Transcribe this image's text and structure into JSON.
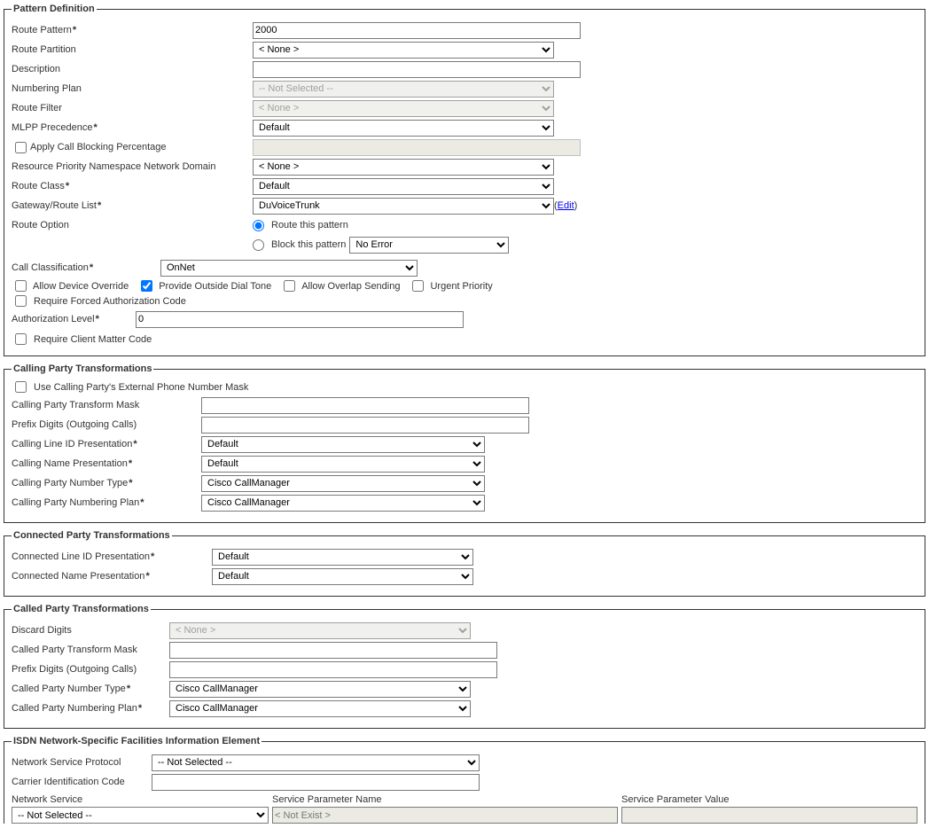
{
  "pd": {
    "legend": "Pattern Definition",
    "route_pattern_label": "Route Pattern",
    "route_pattern_value": "2000",
    "route_partition_label": "Route Partition",
    "route_partition_value": "< None >",
    "description_label": "Description",
    "description_value": "",
    "numbering_plan_label": "Numbering Plan",
    "numbering_plan_value": "-- Not Selected --",
    "route_filter_label": "Route Filter",
    "route_filter_value": "< None >",
    "mlpp_label": "MLPP Precedence",
    "mlpp_value": "Default",
    "apply_blocking_label": "Apply Call Blocking Percentage",
    "rpnnd_label": "Resource Priority Namespace Network Domain",
    "rpnnd_value": "< None >",
    "route_class_label": "Route Class",
    "route_class_value": "Default",
    "gateway_label": "Gateway/Route List",
    "gateway_value": "DuVoiceTrunk",
    "edit_text": "Edit",
    "route_option_label": "Route Option",
    "route_this_label": "Route this pattern",
    "block_this_label": "Block this pattern",
    "block_reason_value": "No Error",
    "call_class_label": "Call Classification",
    "call_class_value": "OnNet",
    "allow_device_override": "Allow Device Override",
    "provide_dial_tone": "Provide Outside Dial Tone",
    "allow_overlap": "Allow Overlap Sending",
    "urgent_priority": "Urgent Priority",
    "require_fac": "Require Forced Authorization Code",
    "auth_level_label": "Authorization Level",
    "auth_level_value": "0",
    "require_cmc": "Require Client Matter Code"
  },
  "cp": {
    "legend": "Calling Party Transformations",
    "use_mask_label": "Use Calling Party's External Phone Number Mask",
    "transform_mask_label": "Calling Party Transform Mask",
    "transform_mask_value": "",
    "prefix_label": "Prefix Digits (Outgoing Calls)",
    "prefix_value": "",
    "line_id_label": "Calling Line ID Presentation",
    "line_id_value": "Default",
    "name_pres_label": "Calling Name Presentation",
    "name_pres_value": "Default",
    "num_type_label": "Calling Party Number Type",
    "num_type_value": "Cisco CallManager",
    "num_plan_label": "Calling Party Numbering Plan",
    "num_plan_value": "Cisco CallManager"
  },
  "conn": {
    "legend": "Connected Party Transformations",
    "line_id_label": "Connected Line ID Presentation",
    "line_id_value": "Default",
    "name_pres_label": "Connected Name Presentation",
    "name_pres_value": "Default"
  },
  "called": {
    "legend": "Called Party Transformations",
    "discard_label": "Discard Digits",
    "discard_value": "< None >",
    "mask_label": "Called Party Transform Mask",
    "mask_value": "",
    "prefix_label": "Prefix Digits (Outgoing Calls)",
    "prefix_value": "",
    "num_type_label": "Called Party Number Type",
    "num_type_value": "Cisco CallManager",
    "num_plan_label": "Called Party Numbering Plan",
    "num_plan_value": "Cisco CallManager"
  },
  "isdn": {
    "legend": "ISDN Network-Specific Facilities Information Element",
    "nsp_label": "Network Service Protocol",
    "nsp_value": "-- Not Selected --",
    "cic_label": "Carrier Identification Code",
    "cic_value": "",
    "ns_hdr": "Network Service",
    "ns_value": "-- Not Selected --",
    "spn_hdr": "Service Parameter Name",
    "spn_value": "< Not Exist >",
    "spv_hdr": "Service Parameter Value",
    "spv_value": ""
  }
}
